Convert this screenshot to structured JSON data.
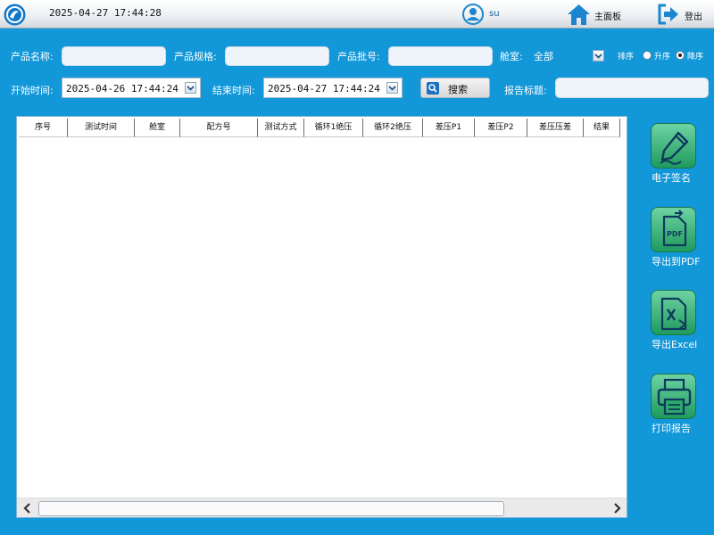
{
  "header": {
    "datetime": "2025-04-27 17:44:28",
    "user": "su",
    "home_label": "主面板",
    "logout_label": "登出"
  },
  "filters": {
    "product_name_label": "产品名称:",
    "product_name_value": "",
    "product_spec_label": "产品规格:",
    "product_spec_value": "",
    "batch_label": "产品批号:",
    "batch_value": "",
    "chamber_label": "舱室:",
    "chamber_value": "全部",
    "sort_label": "排序",
    "sort_asc": "升序",
    "sort_desc": "降序",
    "sort_selected": "降序",
    "start_label": "开始时间:",
    "start_value": "2025-04-26 17:44:24",
    "end_label": "结束时间:",
    "end_value": "2025-04-27 17:44:24",
    "search_label": "搜索",
    "report_title_label": "报告标题:",
    "report_title_value": ""
  },
  "table": {
    "columns": [
      "序号",
      "测试时间",
      "舱室",
      "配方号",
      "测试方式",
      "循环1绝压",
      "循环2绝压",
      "差压P1",
      "差压P2",
      "差压压差",
      "结果"
    ],
    "rows": []
  },
  "actions": {
    "sign_label": "电子签名",
    "pdf_label": "导出到PDF",
    "excel_label": "导出Excel",
    "print_label": "打印报告"
  },
  "colors": {
    "background": "#1297d8",
    "button_green": "#2ea86b"
  }
}
